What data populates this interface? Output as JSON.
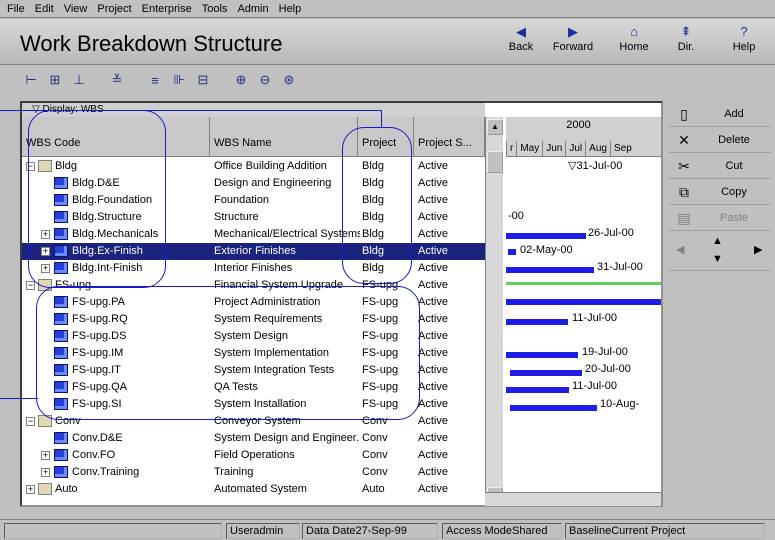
{
  "menu": [
    "File",
    "Edit",
    "View",
    "Project",
    "Enterprise",
    "Tools",
    "Admin",
    "Help"
  ],
  "title": "Work Breakdown Structure",
  "nav": [
    {
      "label": "Back",
      "icon": "back-arrow-icon"
    },
    {
      "label": "Forward",
      "icon": "forward-arrow-icon"
    },
    {
      "label": "Home",
      "icon": "home-icon"
    },
    {
      "label": "Dir.",
      "icon": "directory-icon"
    },
    {
      "label": "Help",
      "icon": "help-icon"
    }
  ],
  "display_label": "Display: WBS",
  "columns": {
    "code": "WBS Code",
    "name": "WBS Name",
    "project": "Project",
    "status": "Project S..."
  },
  "rows": [
    {
      "code": "Bldg",
      "name": "Office Building Addition",
      "project": "Bldg",
      "status": "Active"
    },
    {
      "code": "Bldg.D&E",
      "name": "Design and Engineering",
      "project": "Bldg",
      "status": "Active"
    },
    {
      "code": "Bldg.Foundation",
      "name": "Foundation",
      "project": "Bldg",
      "status": "Active"
    },
    {
      "code": "Bldg.Structure",
      "name": "Structure",
      "project": "Bldg",
      "status": "Active"
    },
    {
      "code": "Bldg.Mechanicals",
      "name": "Mechanical/Electrical Systems",
      "project": "Bldg",
      "status": "Active"
    },
    {
      "code": "Bldg.Ex-Finish",
      "name": "Exterior Finishes",
      "project": "Bldg",
      "status": "Active"
    },
    {
      "code": "Bldg.Int-Finish",
      "name": "Interior Finishes",
      "project": "Bldg",
      "status": "Active"
    },
    {
      "code": "FS-upg",
      "name": "Financial System Upgrade",
      "project": "FS-upg",
      "status": "Active"
    },
    {
      "code": "FS-upg.PA",
      "name": "Project Administration",
      "project": "FS-upg",
      "status": "Active"
    },
    {
      "code": "FS-upg.RQ",
      "name": "System Requirements",
      "project": "FS-upg",
      "status": "Active"
    },
    {
      "code": "FS-upg.DS",
      "name": "System Design",
      "project": "FS-upg",
      "status": "Active"
    },
    {
      "code": "FS-upg.IM",
      "name": "System Implementation",
      "project": "FS-upg",
      "status": "Active"
    },
    {
      "code": "FS-upg.IT",
      "name": "System Integration Tests",
      "project": "FS-upg",
      "status": "Active"
    },
    {
      "code": "FS-upg.QA",
      "name": "QA Tests",
      "project": "FS-upg",
      "status": "Active"
    },
    {
      "code": "FS-upg.SI",
      "name": "System Installation",
      "project": "FS-upg",
      "status": "Active"
    },
    {
      "code": "Conv",
      "name": "Conveyor System",
      "project": "Conv",
      "status": "Active"
    },
    {
      "code": "Conv.D&E",
      "name": "System Design and Engineer...",
      "project": "Conv",
      "status": "Active"
    },
    {
      "code": "Conv.FO",
      "name": "Field Operations",
      "project": "Conv",
      "status": "Active"
    },
    {
      "code": "Conv.Training",
      "name": "Training",
      "project": "Conv",
      "status": "Active"
    },
    {
      "code": "Auto",
      "name": "Automated System",
      "project": "Auto",
      "status": "Active"
    }
  ],
  "gantt": {
    "year": "2000",
    "months": [
      "r",
      "May",
      "Jun",
      "Jul",
      "Aug",
      "Sep"
    ],
    "labels": {
      "bldg": "31-Jul-00",
      "structure": "-00",
      "mechanicals": "26-Jul-00",
      "exfinish": "02-May-00",
      "intfinish": "31-Jul-00",
      "rq": "11-Jul-00",
      "im": "19-Jul-00",
      "it": "20-Jul-00",
      "qa": "11-Jul-00",
      "si": "10-Aug-"
    }
  },
  "side_buttons": [
    {
      "label": "Add",
      "icon": "add-document-icon",
      "enabled": true
    },
    {
      "label": "Delete",
      "icon": "delete-x-icon",
      "enabled": true
    },
    {
      "label": "Cut",
      "icon": "scissors-icon",
      "enabled": true
    },
    {
      "label": "Copy",
      "icon": "copy-icon",
      "enabled": true
    },
    {
      "label": "Paste",
      "icon": "paste-icon",
      "enabled": false
    }
  ],
  "status": {
    "user_label": "User",
    "user": "admin",
    "data_date_label": "Data Date",
    "data_date": "27-Sep-99",
    "access_mode_label": "Access Mode",
    "access_mode": "Shared",
    "baseline_label": "Baseline",
    "baseline": "Current Project"
  }
}
